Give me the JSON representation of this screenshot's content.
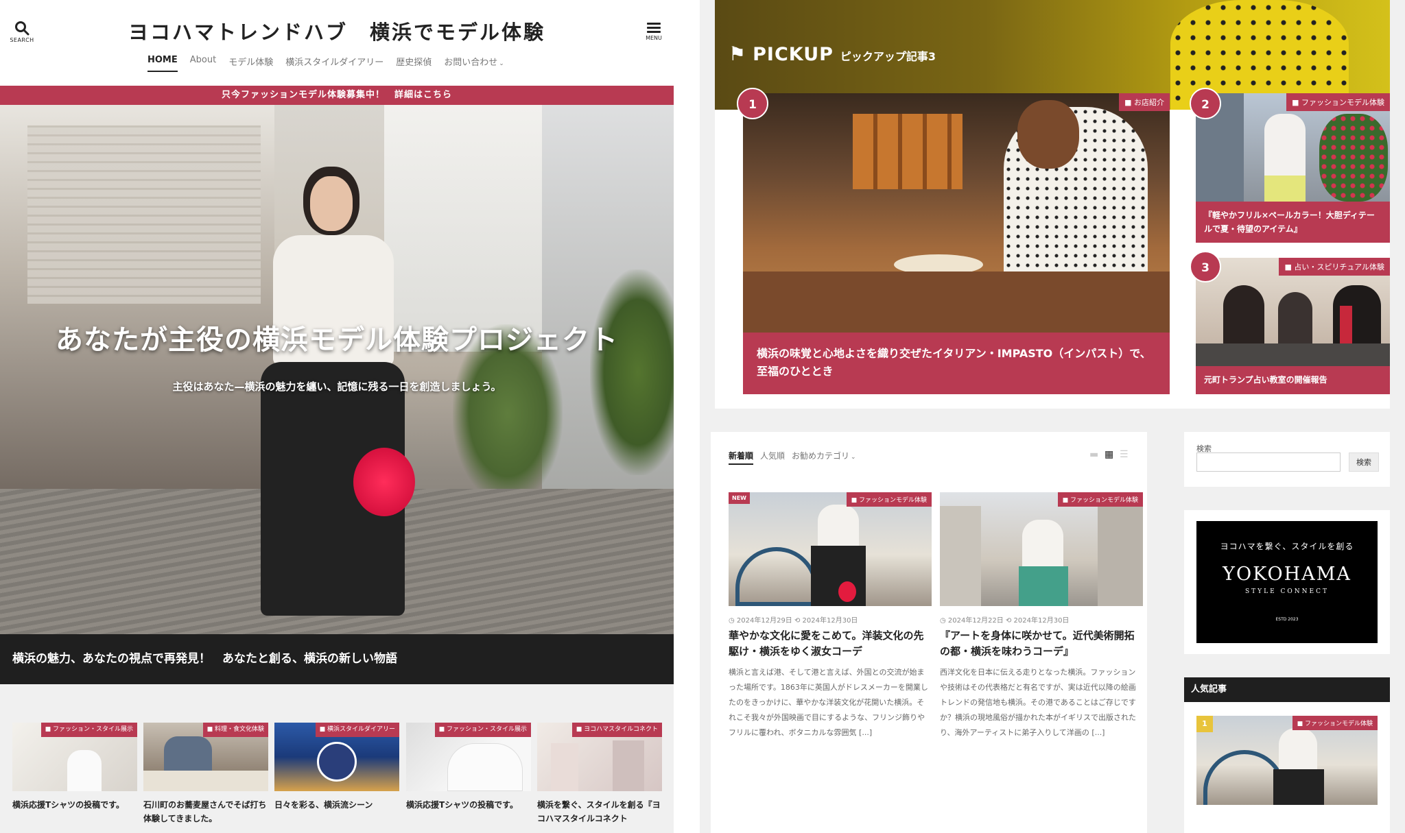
{
  "header": {
    "search_label": "SEARCH",
    "menu_label": "MENU",
    "site_title": "ヨコハマトレンドハブ　横浜でモデル体験",
    "nav": [
      {
        "label": "HOME"
      },
      {
        "label": "About"
      },
      {
        "label": "モデル体験"
      },
      {
        "label": "横浜スタイルダイアリー"
      },
      {
        "label": "歴史探偵"
      },
      {
        "label": "お問い合わせ"
      }
    ]
  },
  "promo_bar": "只今ファッションモデル体験募集中！　詳細はこちら",
  "hero": {
    "title": "あなたが主役の横浜モデル体験プロジェクト",
    "subtitle": "主役はあなた—横浜の魅力を纏い、記憶に残る一日を創造しましょう。"
  },
  "tagline": "横浜の魅力、あなたの視点で再発見！　あなたと創る、横浜の新しい物語",
  "strip_cards": [
    {
      "category": "ファッション・スタイル展示",
      "title": "横浜応援Tシャツの投稿です。"
    },
    {
      "category": "料理・食文化体験",
      "title": "石川町のお蕎麦屋さんでそば打ち体験してきました。"
    },
    {
      "category": "横浜スタイルダイアリー",
      "title": "日々を彩る、横浜流シーン"
    },
    {
      "category": "ファッション・スタイル展示",
      "title": "横浜応援Tシャツの投稿です。"
    },
    {
      "category": "ヨコハマスタイルコネクト",
      "title": "横浜を繋ぐ、スタイルを創る『ヨコハマスタイルコネクト"
    }
  ],
  "pickup": {
    "label_main": "PICKUP",
    "label_sub": "ピックアップ記事3",
    "cards": [
      {
        "num": "1",
        "category": "お店紹介",
        "title": "横浜の味覚と心地よさを織り交ぜたイタリアン・IMPASTO（インパスト）で、至福のひととき"
      },
      {
        "num": "2",
        "category": "ファッションモデル体験",
        "title": "『軽やかフリル×ペールカラー！大胆ディテールで夏・待望のアイテム』"
      },
      {
        "num": "3",
        "category": "占い・スピリチュアル体験",
        "title": "元町トランプ占い教室の開催報告"
      }
    ]
  },
  "articles": {
    "tabs": [
      {
        "label": "新着順"
      },
      {
        "label": "人気順"
      },
      {
        "label": "お勧めカテゴリ"
      }
    ],
    "items": [
      {
        "badge": "NEW",
        "category": "ファッションモデル体験",
        "dates": "◷ 2024年12月29日  ⟲ 2024年12月30日",
        "title": "華やかな文化に愛をこめて。洋装文化の先駆け・横浜をゆく淑女コーデ",
        "excerpt": "横浜と言えば港、そして港と言えば、外国との交流が始まった場所です。1863年に英国人がドレスメーカーを開業したのをきっかけに、華やかな洋装文化が花開いた横浜。それこそ我々が外国映画で目にするような、フリンジ飾りやフリルに覆われ、ボタニカルな雰囲気 [...]"
      },
      {
        "badge": "",
        "category": "ファッションモデル体験",
        "dates": "◷ 2024年12月22日  ⟲ 2024年12月30日",
        "title": "『アートを身体に咲かせて。近代美術開拓の都・横浜を味わうコーデ』",
        "excerpt": "西洋文化を日本に伝える走りとなった横浜。ファッションや技術はその代表格だと有名ですが、実は近代以降の絵画トレンドの発信地も横浜。その港であることはご存じですか？横浜の現地風俗が描かれた本がイギリスで出版されたり、海外アーティストに弟子入りして洋画の [...]"
      }
    ]
  },
  "sidebar": {
    "search_label": "検索",
    "search_value": "",
    "search_button": "検索",
    "banner_line1": "ヨコハマを繋ぐ、スタイルを創る",
    "banner_logo": "YOKOHAMA",
    "banner_logo_sub": "STYLE CONNECT",
    "banner_estd": "ESTD 2023",
    "popular_heading": "人気記事",
    "popular_rank": "1",
    "popular_category": "ファッションモデル体験"
  }
}
